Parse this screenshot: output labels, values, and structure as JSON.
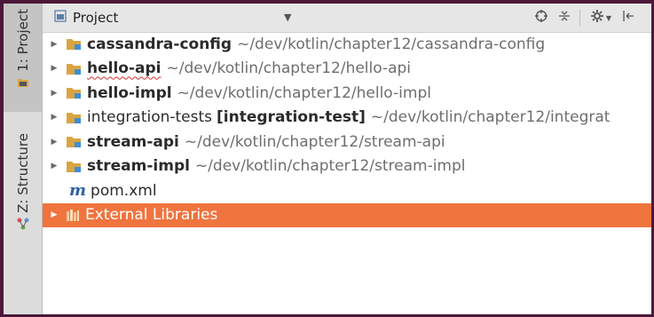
{
  "stripe": {
    "project_tab": "1: Project",
    "structure_tab": "Z: Structure"
  },
  "header": {
    "view_title": "Project"
  },
  "tree": {
    "items": [
      {
        "name": "cassandra-config",
        "path": "~/dev/kotlin/chapter12/cassandra-config"
      },
      {
        "name": "hello-api",
        "path": "~/dev/kotlin/chapter12/hello-api"
      },
      {
        "name": "hello-impl",
        "path": "~/dev/kotlin/chapter12/hello-impl"
      },
      {
        "name": "integration-tests",
        "tag": "[integration-test]",
        "path": "~/dev/kotlin/chapter12/integrat"
      },
      {
        "name": "stream-api",
        "path": "~/dev/kotlin/chapter12/stream-api"
      },
      {
        "name": "stream-impl",
        "path": "~/dev/kotlin/chapter12/stream-impl"
      },
      {
        "name": "pom.xml",
        "icon_letter": "m"
      },
      {
        "name": "External Libraries"
      }
    ]
  },
  "colors": {
    "selection": "#f0743e",
    "folder": "#d9a441",
    "module_marker": "#3d8fd6",
    "maven": "#2c5fa8"
  }
}
